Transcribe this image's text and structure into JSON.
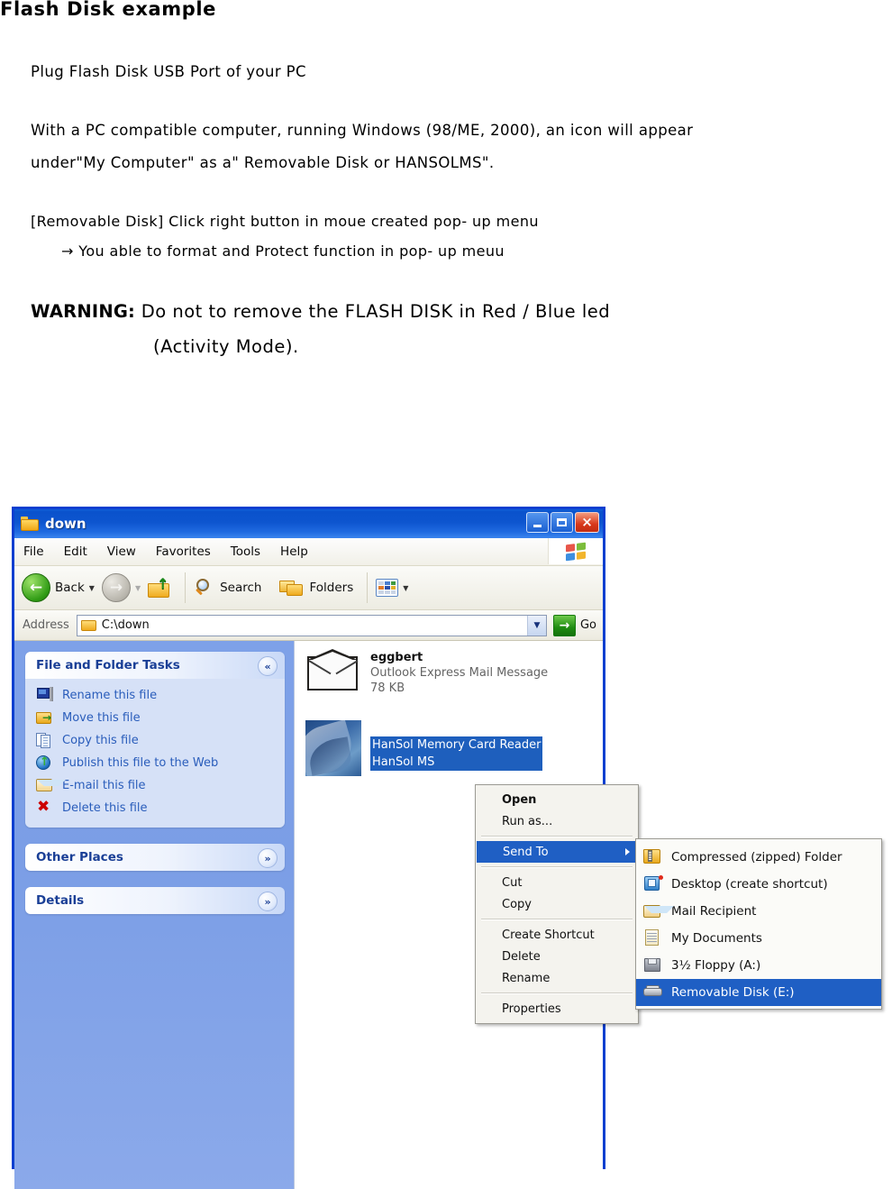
{
  "document": {
    "title": "Flash Disk example",
    "paragraphs": {
      "plug": "Plug Flash Disk USB Port of your PC",
      "with_line1": "With a PC compatible computer, running Windows (98/ME, 2000), an icon will appear",
      "with_line2": "under\"My Computer\" as a\" Removable Disk or HANSOLMS\".",
      "removable": "[Removable Disk]  Click right button in moue created   pop- up menu",
      "arrow_line": "→  You able to   format and Protect function in pop- up meuu",
      "warning_label": "WARNING:",
      "warning_text": " Do not to remove the FLASH DISK in Red / Blue led",
      "warning_line2": "(Activity Mode)."
    }
  },
  "explorer": {
    "window_title": "down",
    "window_buttons": {
      "minimize": "minimize-button",
      "maximize": "maximize-button",
      "close": "×"
    },
    "menubar": [
      "File",
      "Edit",
      "View",
      "Favorites",
      "Tools",
      "Help"
    ],
    "toolbar": {
      "back_label": "Back",
      "forward_label": "",
      "up_label": "",
      "search_label": "Search",
      "folders_label": "Folders",
      "views_label": ""
    },
    "addressbar": {
      "label": "Address",
      "value": "C:\\down",
      "go_label": "Go"
    },
    "sidebar": {
      "panels": [
        {
          "title": "File and Folder Tasks",
          "collapse_glyph": "«",
          "items": [
            {
              "label": "Rename this file",
              "icon": "rename-icon"
            },
            {
              "label": "Move this file",
              "icon": "move-icon"
            },
            {
              "label": "Copy this file",
              "icon": "copy-icon"
            },
            {
              "label": "Publish this file to the Web",
              "icon": "publish-icon"
            },
            {
              "label": "E-mail this file",
              "icon": "email-icon"
            },
            {
              "label": "Delete this file",
              "icon": "delete-icon"
            }
          ]
        },
        {
          "title": "Other Places",
          "collapse_glyph": "»",
          "items": []
        },
        {
          "title": "Details",
          "collapse_glyph": "»",
          "items": []
        }
      ]
    },
    "files": [
      {
        "name": "eggbert",
        "type": "Outlook Express Mail Message",
        "size": "78 KB",
        "selected": false
      },
      {
        "name": "HanSol Memory Card Reader",
        "name2": "HanSol MS",
        "selected": true
      }
    ]
  },
  "context_menu": {
    "items": [
      {
        "label": "Open",
        "bold": true,
        "selected": false,
        "submenu": false
      },
      {
        "label": "Run as...",
        "bold": false,
        "selected": false,
        "submenu": false
      },
      {
        "separator": true
      },
      {
        "label": "Send To",
        "bold": false,
        "selected": true,
        "submenu": true
      },
      {
        "separator": true
      },
      {
        "label": "Cut",
        "bold": false,
        "selected": false,
        "submenu": false
      },
      {
        "label": "Copy",
        "bold": false,
        "selected": false,
        "submenu": false
      },
      {
        "separator": true
      },
      {
        "label": "Create Shortcut",
        "bold": false,
        "selected": false,
        "submenu": false
      },
      {
        "label": "Delete",
        "bold": false,
        "selected": false,
        "submenu": false
      },
      {
        "label": "Rename",
        "bold": false,
        "selected": false,
        "submenu": false
      },
      {
        "separator": true
      },
      {
        "label": "Properties",
        "bold": false,
        "selected": false,
        "submenu": false
      }
    ]
  },
  "send_to_submenu": {
    "items": [
      {
        "label": "Compressed (zipped) Folder",
        "icon": "zip-folder-icon",
        "selected": false
      },
      {
        "label": "Desktop (create shortcut)",
        "icon": "desktop-shortcut-icon",
        "selected": false
      },
      {
        "label": "Mail Recipient",
        "icon": "mail-icon",
        "selected": false
      },
      {
        "label": "My Documents",
        "icon": "documents-icon",
        "selected": false
      },
      {
        "label": "3½ Floppy (A:)",
        "icon": "floppy-icon",
        "selected": false
      },
      {
        "label": "Removable Disk (E:)",
        "icon": "removable-disk-icon",
        "selected": true
      }
    ]
  },
  "colors": {
    "titlebar_blue": "#0a52cc",
    "window_border": "#0a3fd0",
    "selection_blue": "#1f5fc4",
    "sidebar_blue": "#7ea1e8",
    "link_blue": "#2a5dbb",
    "panel_title": "#1a3f96"
  }
}
